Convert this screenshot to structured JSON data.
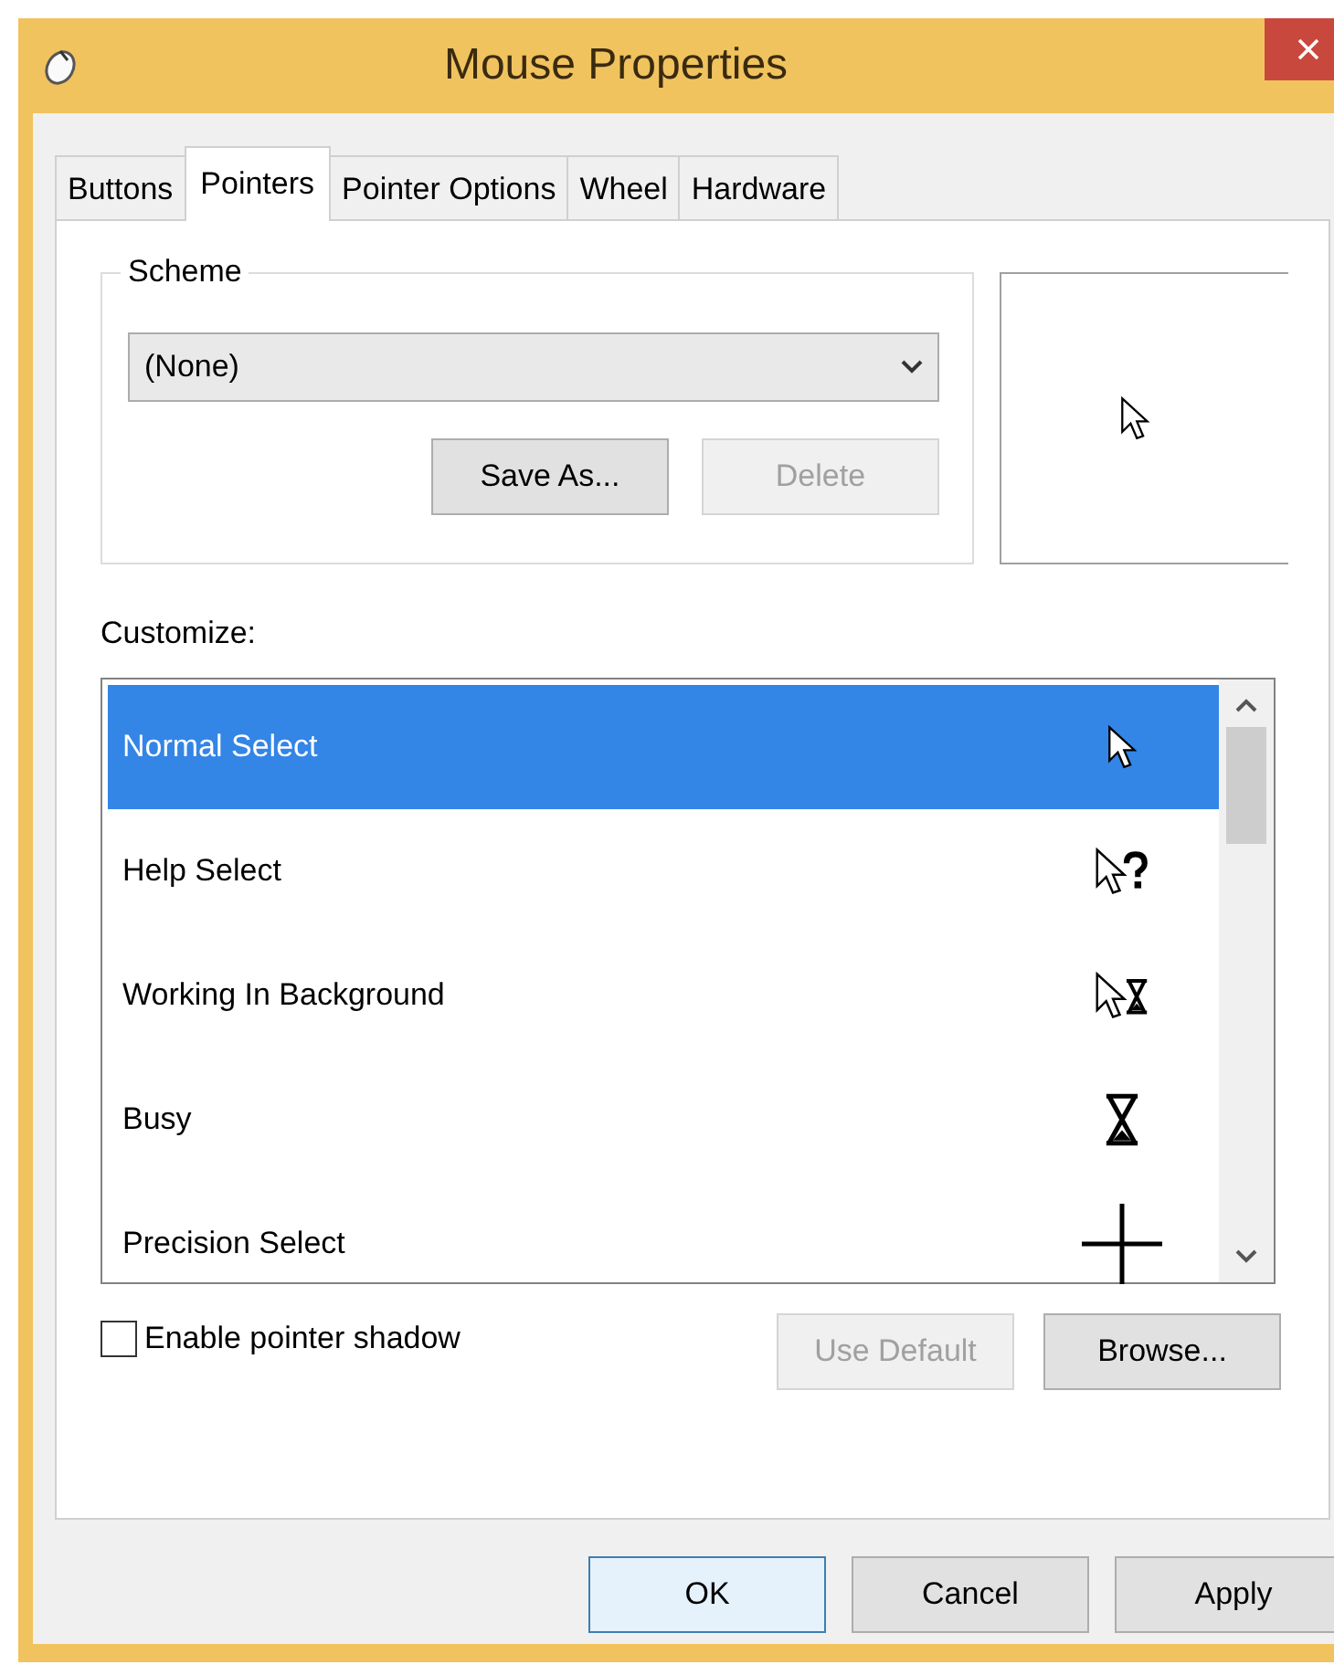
{
  "window": {
    "title": "Mouse Properties"
  },
  "tabs": [
    {
      "label": "Buttons",
      "selected": false
    },
    {
      "label": "Pointers",
      "selected": true
    },
    {
      "label": "Pointer Options",
      "selected": false
    },
    {
      "label": "Wheel",
      "selected": false
    },
    {
      "label": "Hardware",
      "selected": false
    }
  ],
  "scheme": {
    "label": "Scheme",
    "value": "(None)",
    "buttons": [
      {
        "label": "Save As...",
        "disabled": false
      },
      {
        "label": "Delete",
        "disabled": true
      }
    ]
  },
  "preview": {
    "kind": "arrow"
  },
  "customize": {
    "label": "Customize:",
    "items": [
      {
        "label": "Normal Select",
        "kind": "arrow",
        "selected": true
      },
      {
        "label": "Help Select",
        "kind": "help",
        "selected": false
      },
      {
        "label": "Working In Background",
        "kind": "working",
        "selected": false
      },
      {
        "label": "Busy",
        "kind": "busy",
        "selected": false
      },
      {
        "label": "Precision Select",
        "kind": "cross",
        "selected": false
      }
    ]
  },
  "shadow": {
    "label": "Enable pointer shadow",
    "checked": false
  },
  "list_buttons": [
    {
      "label": "Use Default",
      "disabled": true
    },
    {
      "label": "Browse...",
      "disabled": false
    }
  ],
  "footer_buttons": [
    {
      "label": "OK",
      "default": true
    },
    {
      "label": "Cancel",
      "default": false
    },
    {
      "label": "Apply",
      "default": false
    }
  ]
}
